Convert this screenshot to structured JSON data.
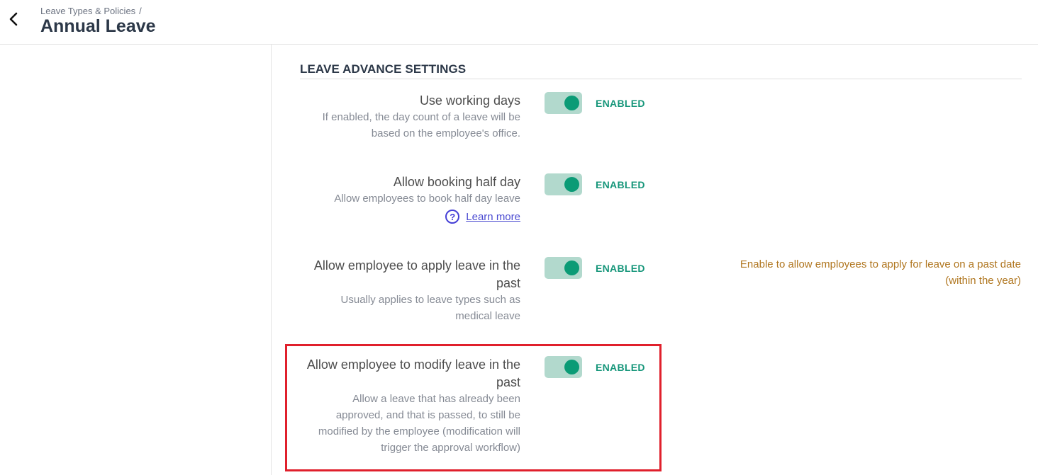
{
  "header": {
    "breadcrumb": "Leave Types & Policies",
    "breadcrumb_sep": "/",
    "title": "Annual Leave",
    "back_icon": "chevron-left-icon"
  },
  "section": {
    "title": "LEAVE ADVANCE SETTINGS"
  },
  "settings": [
    {
      "label": "Use working days",
      "desc_lines": [
        "If enabled, the day count of a leave will be",
        "based on the employee's office."
      ],
      "enabled": true,
      "status": "ENABLED"
    },
    {
      "label": "Allow booking half day",
      "desc_lines": [
        "Allow employees to book half day leave"
      ],
      "learn_more": "Learn more",
      "help_icon": "question-circle-icon",
      "enabled": true,
      "status": "ENABLED"
    },
    {
      "label_lines": [
        "Allow employee to apply leave in the",
        "past"
      ],
      "desc_lines": [
        "Usually applies to leave types such as",
        "medical leave"
      ],
      "hint_lines": [
        "Enable to allow employees to apply for leave on a past date",
        "(within the year)"
      ],
      "enabled": true,
      "status": "ENABLED"
    },
    {
      "label_lines": [
        "Allow employee to modify leave in the",
        "past"
      ],
      "desc_lines": [
        "Allow a leave that has already been",
        "approved, and that is passed, to still be",
        "modified by the employee (modification will",
        "trigger the approval workflow)"
      ],
      "enabled": true,
      "status": "ENABLED"
    }
  ],
  "colors": {
    "accent": "#0b9b76",
    "toggle_track": "#b2d9cd",
    "hint": "#b0761f",
    "highlight_border": "#e0202c",
    "link": "#4a4ad1"
  }
}
